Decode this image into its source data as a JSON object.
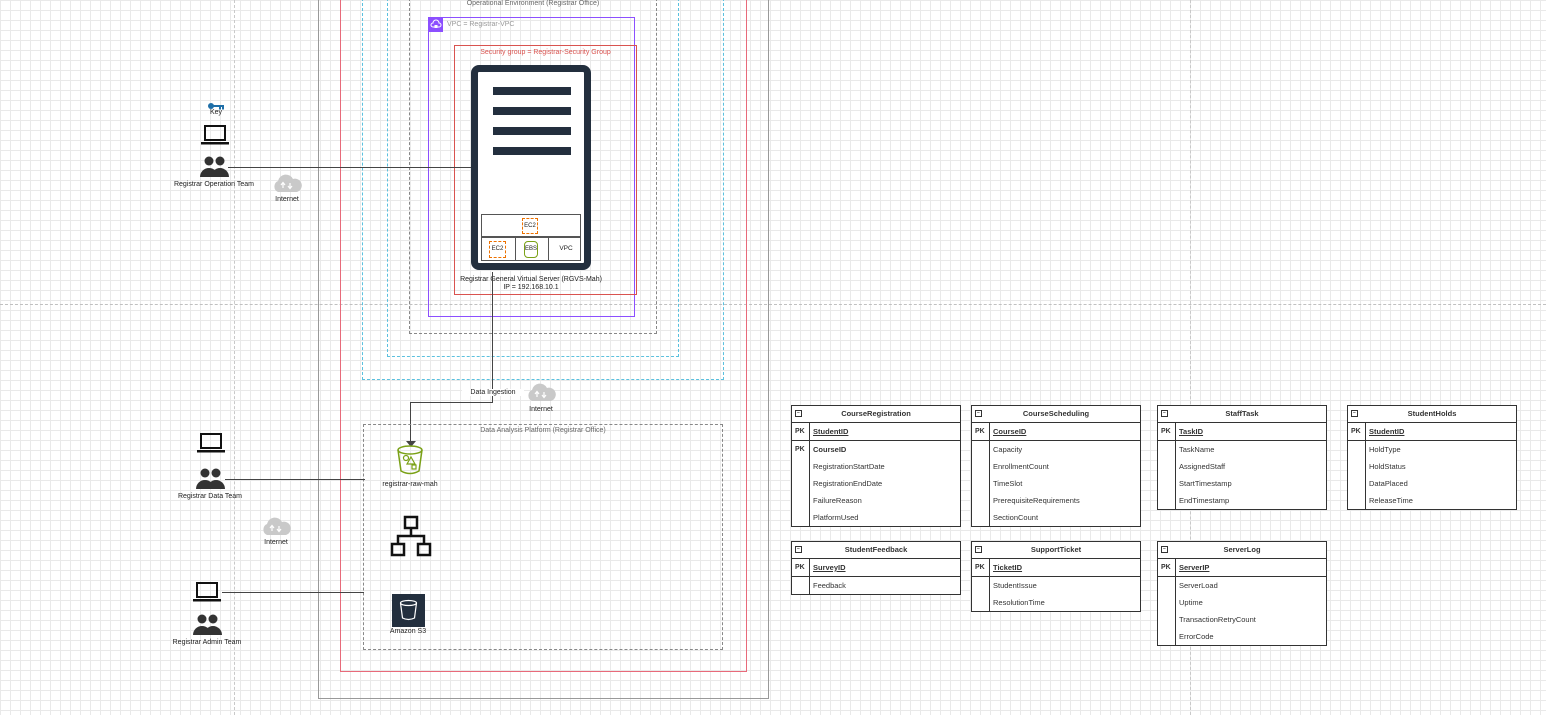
{
  "diagram": {
    "env_label": "Operational Environment (Registrar Office)",
    "vpc_label": "VPC = Registrar-VPC",
    "sg_label": "Security group = Registrar-Security Group",
    "server_name": "Registrar General Virtual Server (RGVS-Mah)",
    "server_ip": "IP = 192.168.10.1",
    "chips": {
      "ec2_top": "EC2",
      "ec2": "EC2",
      "ebs": "EBS",
      "vpc": "VPC"
    },
    "data_ingestion_label": "Data Ingestion",
    "dap_label": "Data Analysis Platform (Registrar Office)",
    "bucket_label": "registrar-raw-mah",
    "s3_label": "Amazon S3",
    "key_label": "Key",
    "internet_labels": [
      "Internet",
      "Internet",
      "Internet"
    ],
    "teams": {
      "operation": "Registrar Operation Team",
      "data": "Registrar Data Team",
      "admin": "Registrar Admin Team"
    }
  },
  "entities": [
    {
      "name": "CourseRegistration",
      "pk": [
        [
          "PK",
          "StudentID"
        ]
      ],
      "rows": [
        [
          "PK",
          "CourseID",
          true
        ],
        [
          "",
          "RegistrationStartDate",
          false
        ],
        [
          "",
          "RegistrationEndDate",
          false
        ],
        [
          "",
          "FailureReason",
          false
        ],
        [
          "",
          "PlatformUsed",
          false
        ]
      ]
    },
    {
      "name": "CourseScheduling",
      "pk": [
        [
          "PK",
          "CourseID"
        ]
      ],
      "rows": [
        [
          "",
          "Capacity",
          false
        ],
        [
          "",
          "EnrollmentCount",
          false
        ],
        [
          "",
          "TimeSlot",
          false
        ],
        [
          "",
          "PrerequisiteRequirements",
          false
        ],
        [
          "",
          "SectionCount",
          false
        ]
      ]
    },
    {
      "name": "StaffTask",
      "pk": [
        [
          "PK",
          "TaskID"
        ]
      ],
      "rows": [
        [
          "",
          "TaskName",
          false
        ],
        [
          "",
          "AssignedStaff",
          false
        ],
        [
          "",
          "StartTimestamp",
          false
        ],
        [
          "",
          "EndTimestamp",
          false
        ]
      ]
    },
    {
      "name": "StudentHolds",
      "pk": [
        [
          "PK",
          "StudentID"
        ]
      ],
      "rows": [
        [
          "",
          "HoldType",
          false
        ],
        [
          "",
          "HoldStatus",
          false
        ],
        [
          "",
          "DataPlaced",
          false
        ],
        [
          "",
          "ReleaseTime",
          false
        ]
      ]
    },
    {
      "name": "StudentFeedback",
      "pk": [
        [
          "PK",
          "SurveyID"
        ]
      ],
      "rows": [
        [
          "",
          "Feedback",
          false
        ]
      ]
    },
    {
      "name": "SupportTicket",
      "pk": [
        [
          "PK",
          "TicketID"
        ]
      ],
      "rows": [
        [
          "",
          "StudentIssue",
          false
        ],
        [
          "",
          "ResolutionTime",
          false
        ]
      ]
    },
    {
      "name": "ServerLog",
      "pk": [
        [
          "PK",
          "ServerIP"
        ]
      ],
      "rows": [
        [
          "",
          "ServerLoad",
          false
        ],
        [
          "",
          "Uptime",
          false
        ],
        [
          "",
          "TransactionRetryCount",
          false
        ],
        [
          "",
          "ErrorCode",
          false
        ]
      ]
    }
  ],
  "colors": {
    "security_group": "#d9534f",
    "vpc": "#8c4fff",
    "dashed_teal": "#5bc0de",
    "ec2": "#ed7100",
    "ebs": "#7aa116",
    "s3_bg": "#232f3e"
  }
}
